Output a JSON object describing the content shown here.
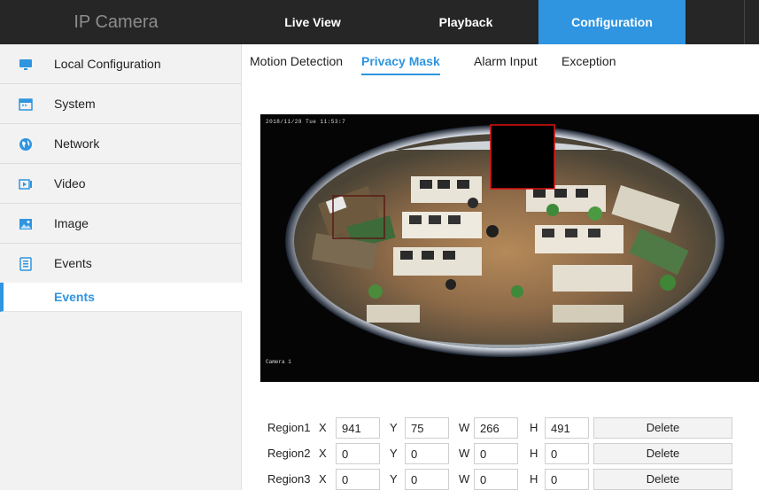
{
  "app": {
    "title": "IP Camera"
  },
  "nav": {
    "live_view": "Live View",
    "playback": "Playback",
    "configuration": "Configuration"
  },
  "sidebar": {
    "items": [
      {
        "label": "Local Configuration",
        "icon": "monitor-icon"
      },
      {
        "label": "System",
        "icon": "system-icon"
      },
      {
        "label": "Network",
        "icon": "globe-icon"
      },
      {
        "label": "Video",
        "icon": "video-icon"
      },
      {
        "label": "Image",
        "icon": "image-icon"
      },
      {
        "label": "Events",
        "icon": "events-icon"
      }
    ],
    "active_sub": "Events"
  },
  "tabs": {
    "motion": "Motion Detection",
    "privacy": "Privacy Mask",
    "alarm": "Alarm Input",
    "exception": "Exception"
  },
  "video": {
    "osd_time": "2018/11/28 Tue 11:53:7",
    "osd_name": "Camera 1"
  },
  "regions": [
    {
      "label": "Region1",
      "x": "941",
      "y": "75",
      "w": "266",
      "h": "491",
      "delete": "Delete"
    },
    {
      "label": "Region2",
      "x": "0",
      "y": "0",
      "w": "0",
      "h": "0",
      "delete": "Delete"
    },
    {
      "label": "Region3",
      "x": "0",
      "y": "0",
      "w": "0",
      "h": "0",
      "delete": "Delete"
    }
  ],
  "axis_labels": {
    "x": "X",
    "y": "Y",
    "w": "W",
    "h": "H"
  },
  "colors": {
    "accent": "#2f95e0",
    "header": "#262626",
    "mask_border": "#e01010"
  }
}
